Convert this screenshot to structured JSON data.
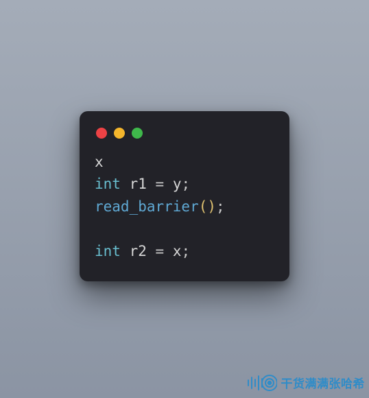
{
  "window": {
    "traffic_lights": [
      "red",
      "yellow",
      "green"
    ]
  },
  "code": {
    "lines": [
      [
        {
          "text": "x",
          "cls": "tk-var"
        }
      ],
      [
        {
          "text": "int",
          "cls": "tk-type"
        },
        {
          "text": " ",
          "cls": ""
        },
        {
          "text": "r1",
          "cls": "tk-var"
        },
        {
          "text": " = ",
          "cls": "tk-op"
        },
        {
          "text": "y",
          "cls": "tk-var"
        },
        {
          "text": ";",
          "cls": "tk-semi"
        }
      ],
      [
        {
          "text": "read_barrier",
          "cls": "tk-call"
        },
        {
          "text": "(",
          "cls": "tk-paren"
        },
        {
          "text": ")",
          "cls": "tk-paren"
        },
        {
          "text": ";",
          "cls": "tk-semi"
        }
      ],
      [],
      [
        {
          "text": "int",
          "cls": "tk-type"
        },
        {
          "text": " ",
          "cls": ""
        },
        {
          "text": "r2",
          "cls": "tk-var"
        },
        {
          "text": " = ",
          "cls": "tk-op"
        },
        {
          "text": "x",
          "cls": "tk-var"
        },
        {
          "text": ";",
          "cls": "tk-semi"
        }
      ]
    ]
  },
  "watermark": {
    "text": "干货满满张哈希"
  }
}
